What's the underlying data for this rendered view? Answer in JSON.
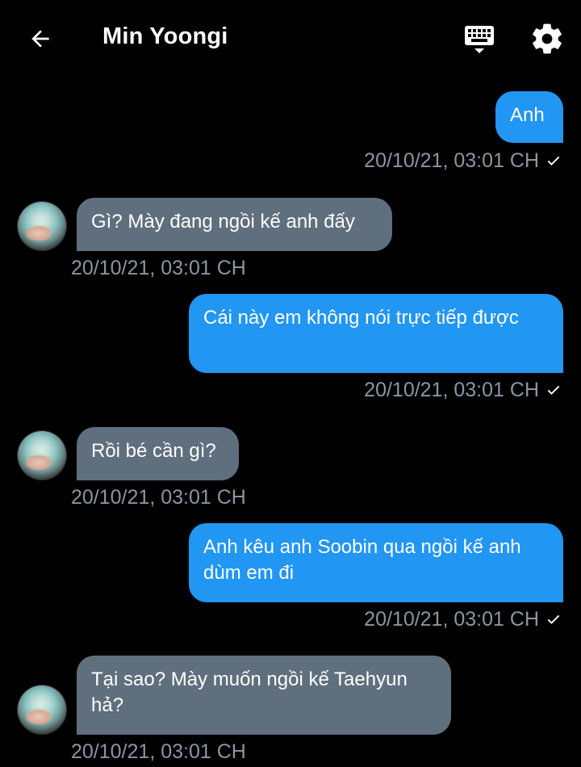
{
  "header": {
    "title": "Min Yoongi",
    "back_icon": "arrow-left-icon",
    "keyboard_icon": "keyboard-icon",
    "settings_icon": "gear-icon"
  },
  "colors": {
    "background": "#000000",
    "outgoing_bubble": "#2196f3",
    "incoming_bubble": "#5f6f7e",
    "timestamp": "#8a96a3"
  },
  "messages": [
    {
      "direction": "out",
      "text": "Anh",
      "time": "20/10/21, 03:01 CH",
      "status": "sent"
    },
    {
      "direction": "in",
      "text": "Gì? Mày đang ngồi kế anh đấy",
      "time": "20/10/21, 03:01 CH"
    },
    {
      "direction": "out",
      "text": "Cái này em không nói trực tiếp được",
      "time": "20/10/21, 03:01 CH",
      "status": "sent"
    },
    {
      "direction": "in",
      "text": "Rồi bé cần gì?",
      "time": "20/10/21, 03:01 CH"
    },
    {
      "direction": "out",
      "text": "Anh kêu anh Soobin qua ngồi kế anh dùm em đi",
      "time": "20/10/21, 03:01 CH",
      "status": "sent"
    },
    {
      "direction": "in",
      "text": "Tại sao? Mày muốn ngồi kế Taehyun hả?",
      "time": "20/10/21, 03:01 CH"
    }
  ]
}
